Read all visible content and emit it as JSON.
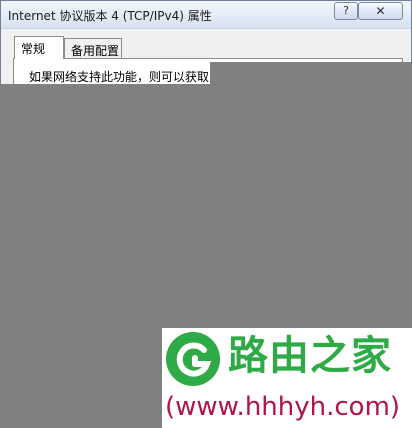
{
  "window": {
    "title": "Internet 协议版本 4 (TCP/IPv4) 属性",
    "help_label": "?",
    "close_label": "✕"
  },
  "tabs": [
    {
      "label": "常规",
      "selected": true
    },
    {
      "label": "备用配置",
      "selected": false
    }
  ],
  "general": {
    "intro_text": "如果网络支持此功能，则可以获取"
  },
  "watermark": {
    "brand": "路由之家",
    "url": "(www.hhhyh.com)"
  },
  "colors": {
    "brand_green": "#2eaa46",
    "url_red": "#b01448",
    "overlay_gray": "#808080"
  }
}
